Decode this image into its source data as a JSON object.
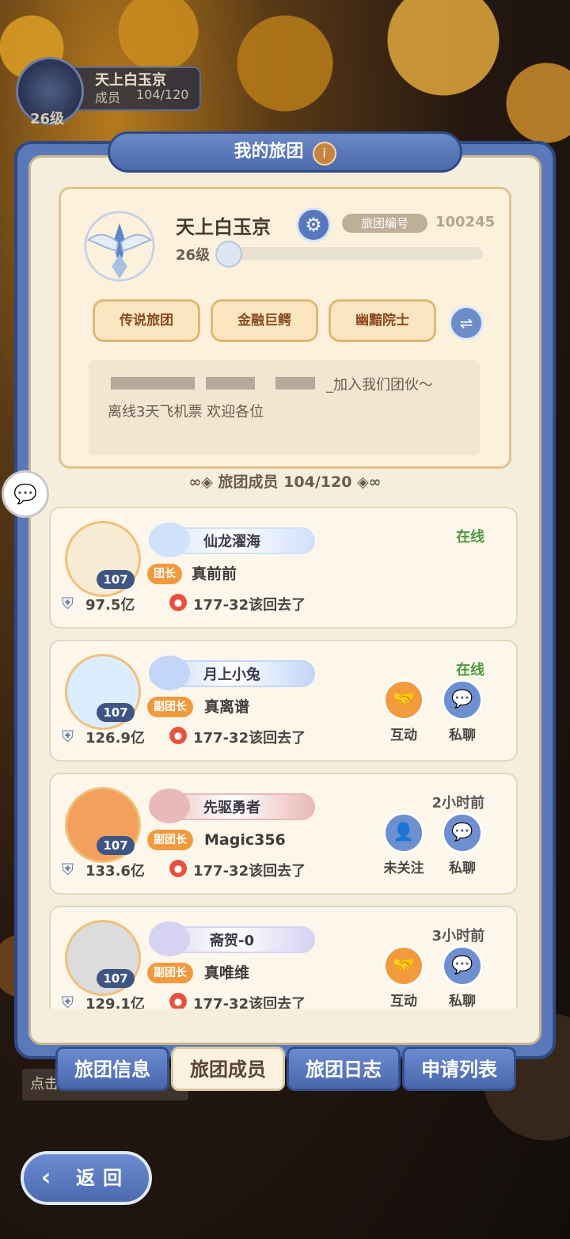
{
  "top_guild": {
    "name": "天上白玉京",
    "members_label": "成员",
    "members_value": "104/120",
    "level": "26级"
  },
  "panel": {
    "title": "我的旅团",
    "info_icon": "i"
  },
  "guild": {
    "name": "天上白玉京",
    "id_label": "旅团编号",
    "id_value": "100245",
    "level": "26级",
    "level_progress": 0.02,
    "tags": [
      "传说旅团",
      "金融巨鳄",
      "幽黯院士"
    ],
    "notice_line1": "_加入我们团伙～",
    "notice_line2": "离线3天飞机票 欢迎各位"
  },
  "members_header": "旅团成员 104/120",
  "members": [
    {
      "title": "仙龙濯海",
      "role": "团长",
      "nickname": "真前前",
      "level": "107",
      "power": "97.5亿",
      "location": "177-32该回去了",
      "status": "在线",
      "status_color": "#4b9a3c",
      "actions": [],
      "plate_color": "#cfe1fb",
      "avatar_color": "#f6ebd3"
    },
    {
      "title": "月上小兔",
      "role": "副团长",
      "nickname": "真离谱",
      "level": "107",
      "power": "126.9亿",
      "location": "177-32该回去了",
      "status": "在线",
      "status_color": "#4b9a3c",
      "actions": [
        {
          "icon": "handshake-icon",
          "label": "互动",
          "color": "#f19a3e"
        },
        {
          "icon": "chat-icon",
          "label": "私聊",
          "color": "#6e8fd0"
        }
      ],
      "plate_color": "#c3d6f7",
      "avatar_color": "#dbeeff"
    },
    {
      "title": "先驱勇者",
      "role": "副团长",
      "nickname": "Magic356",
      "level": "107",
      "power": "133.6亿",
      "location": "177-32该回去了",
      "status": "2小时前",
      "status_color": "#5a5a5a",
      "actions": [
        {
          "icon": "add-friend-icon",
          "label": "未关注",
          "color": "#6e8fd0"
        },
        {
          "icon": "chat-icon",
          "label": "私聊",
          "color": "#6e8fd0"
        }
      ],
      "plate_color": "#e9b9b7",
      "avatar_color": "#f3a05c"
    },
    {
      "title": "斋贺-0",
      "role": "副团长",
      "nickname": "真唯维",
      "level": "107",
      "power": "129.1亿",
      "location": "177-32该回去了",
      "status": "3小时前",
      "status_color": "#5a5a5a",
      "actions": [
        {
          "icon": "handshake-icon",
          "label": "互动",
          "color": "#f19a3e"
        },
        {
          "icon": "chat-icon",
          "label": "私聊",
          "color": "#6e8fd0"
        }
      ],
      "plate_color": "#d6d2f2",
      "avatar_color": "#dcdcdc"
    }
  ],
  "tabs": [
    "旅团信息",
    "旅团成员",
    "旅团日志",
    "申请列表"
  ],
  "active_tab": 1,
  "hint": "点击",
  "back_label": "返回"
}
